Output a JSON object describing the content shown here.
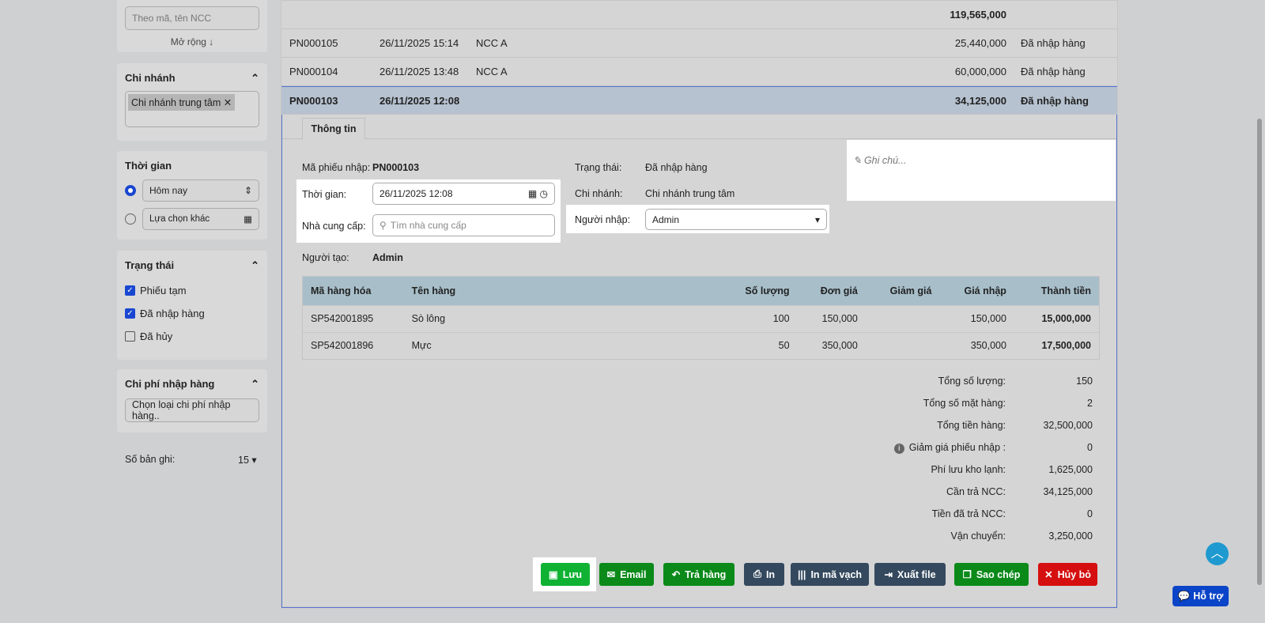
{
  "sidebar": {
    "supplier_search_placeholder": "Theo mã, tên NCC",
    "expand": "Mở rộng ↓",
    "branch": {
      "title": "Chi nhánh",
      "tag": "Chi nhánh trung tâm"
    },
    "time": {
      "title": "Thời gian",
      "option1": "Hôm nay",
      "option2": "Lựa chọn khác"
    },
    "status": {
      "title": "Trạng thái",
      "items": [
        {
          "label": "Phiếu tạm",
          "checked": true
        },
        {
          "label": "Đã nhập hàng",
          "checked": true
        },
        {
          "label": "Đã hủy",
          "checked": false
        }
      ]
    },
    "cost": {
      "title": "Chi phí nhập hàng",
      "placeholder": "Chọn loại chi phí nhập hàng.."
    },
    "records": {
      "label": "Số bản ghi:",
      "value": "15"
    }
  },
  "list": {
    "total": "119,565,000",
    "rows": [
      {
        "code": "PN000105",
        "time": "26/11/2025 15:14",
        "supplier": "NCC A",
        "amount": "25,440,000",
        "status": "Đã nhập hàng"
      },
      {
        "code": "PN000104",
        "time": "26/11/2025 13:48",
        "supplier": "NCC A",
        "amount": "60,000,000",
        "status": "Đã nhập hàng"
      },
      {
        "code": "PN000103",
        "time": "26/11/2025 12:08",
        "supplier": "",
        "amount": "34,125,000",
        "status": "Đã nhập hàng"
      }
    ]
  },
  "detail": {
    "tab": "Thông tin",
    "code_label": "Mã phiếu nhập:",
    "code": "PN000103",
    "time_label": "Thời gian:",
    "time": "26/11/2025 12:08",
    "supplier_label": "Nhà cung cấp:",
    "supplier_placeholder": "Tìm nhà cung cấp",
    "creator_label": "Người tạo:",
    "creator": "Admin",
    "status_label": "Trạng thái:",
    "status": "Đã nhập hàng",
    "branch_label": "Chi nhánh:",
    "branch": "Chi nhánh trung tâm",
    "importer_label": "Người nhập:",
    "importer": "Admin",
    "note_placeholder": "Ghi chú...",
    "columns": [
      "Mã hàng hóa",
      "Tên hàng",
      "Số lượng",
      "Đơn giá",
      "Giảm giá",
      "Giá nhập",
      "Thành tiền"
    ],
    "items": [
      [
        "SP542001895",
        "Sò lông",
        "100",
        "150,000",
        "",
        "150,000",
        "15,000,000"
      ],
      [
        "SP542001896",
        "Mực",
        "50",
        "350,000",
        "",
        "350,000",
        "17,500,000"
      ]
    ],
    "totals": [
      {
        "label": "Tổng số lượng:",
        "value": "150"
      },
      {
        "label": "Tổng số mặt hàng:",
        "value": "2"
      },
      {
        "label": "Tổng tiền hàng:",
        "value": "32,500,000"
      },
      {
        "label": "Giảm giá phiếu nhập :",
        "value": "0"
      },
      {
        "label": "Phí lưu kho lạnh:",
        "value": "1,625,000"
      },
      {
        "label": "Cần trả NCC:",
        "value": "34,125,000"
      },
      {
        "label": "Tiền đã trả NCC:",
        "value": "0"
      },
      {
        "label": "Vận chuyển:",
        "value": "3,250,000"
      }
    ],
    "buttons": {
      "save": "Lưu",
      "email": "Email",
      "return": "Trả hàng",
      "print": "In",
      "barcode": "In mã vạch",
      "export": "Xuất file",
      "copy": "Sao chép",
      "cancel": "Hủy bỏ"
    }
  },
  "support": "Hỗ trợ"
}
